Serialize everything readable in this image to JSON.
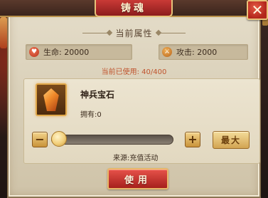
{
  "window": {
    "title": "铸魂",
    "close_symbol": "✕"
  },
  "attributes": {
    "section_title": "当前属性",
    "life_label": "生命: 20000",
    "attack_label": "攻击: 2000",
    "used_text": "当前已使用: 40/400",
    "life_icon": "heart-icon",
    "attack_icon": "sword-icon"
  },
  "item": {
    "name": "神兵宝石",
    "owned_text": "拥有:0",
    "icon": "gem-icon",
    "source_text": "来源:充值活动"
  },
  "stepper": {
    "minus_label": "−",
    "plus_label": "+",
    "max_label": "最大",
    "slider_value": 0
  },
  "actions": {
    "use_label": "使用"
  },
  "colors": {
    "title_red": "#c93a36",
    "accent_gold": "#e7c27a",
    "used_text_color": "#c0542e"
  }
}
